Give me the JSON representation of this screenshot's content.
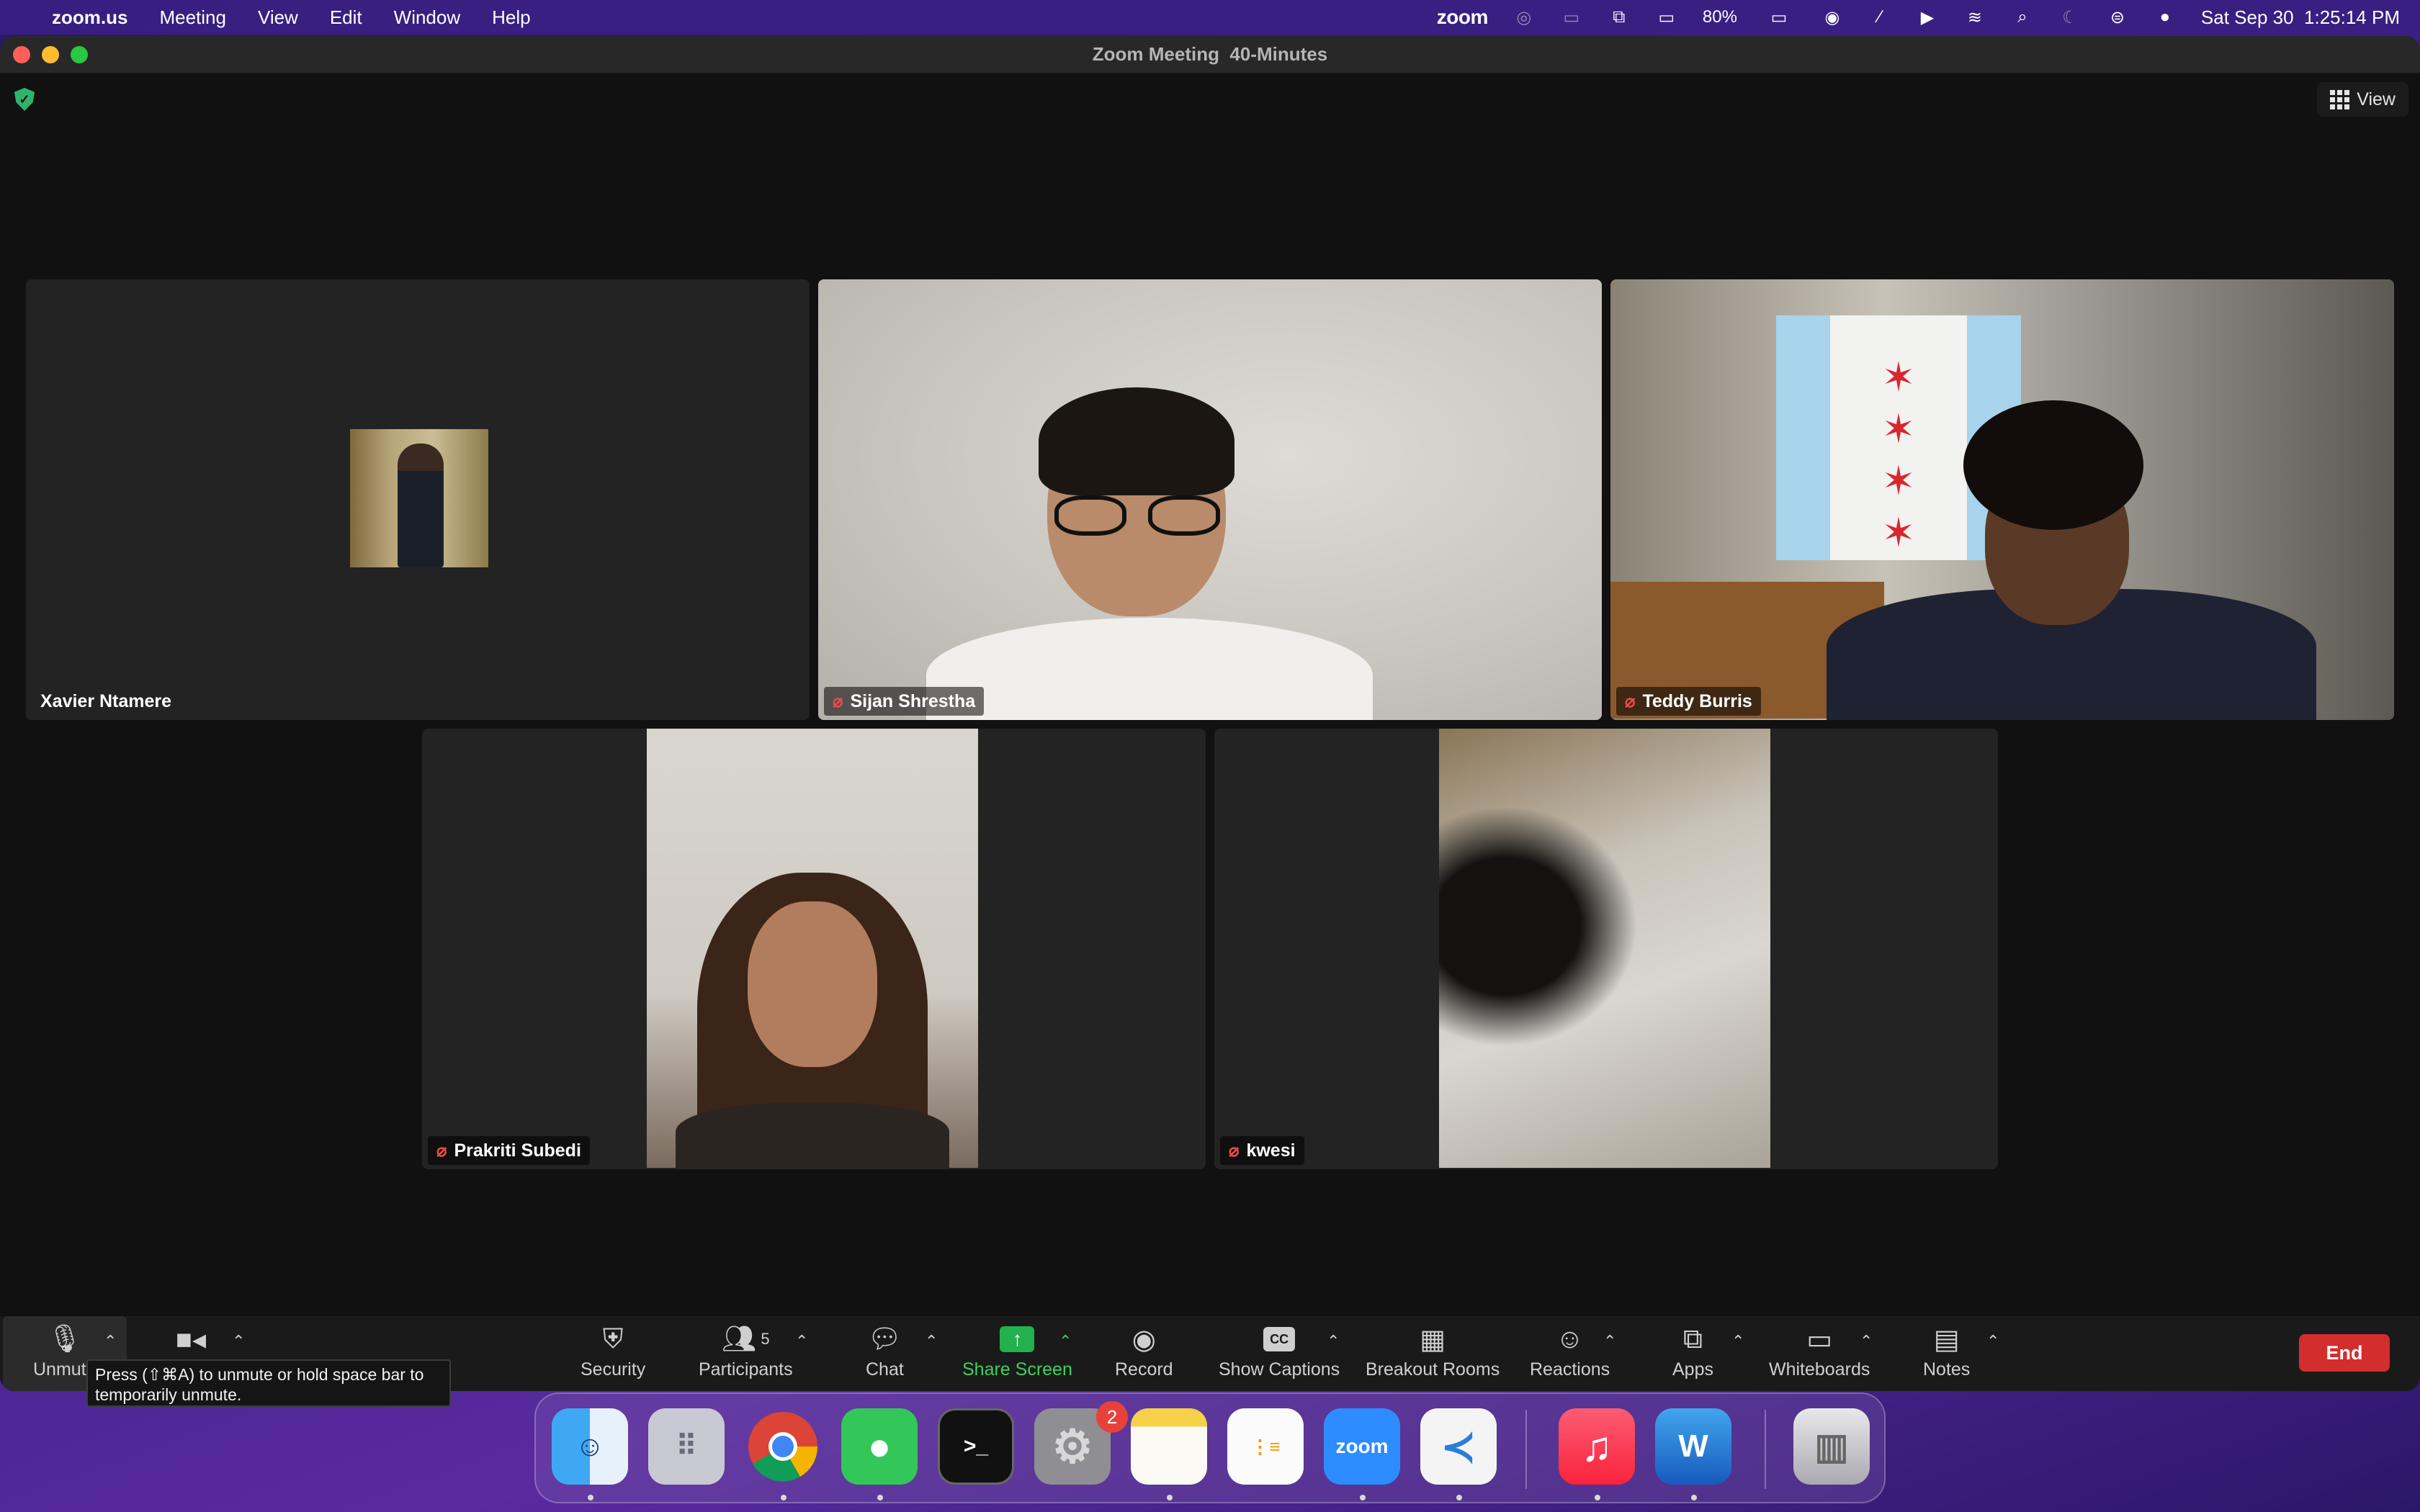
{
  "menubar": {
    "app_name": "zoom.us",
    "menus": [
      "Meeting",
      "View",
      "Edit",
      "Window",
      "Help"
    ],
    "zoom_label": "zoom",
    "battery": "80%",
    "datetime": "Sat Sep 30  1:25:14 PM"
  },
  "window": {
    "title": "Zoom Meeting  40-Minutes",
    "view_label": "View"
  },
  "participants": {
    "xavier": "Xavier Ntamere",
    "sijan": "Sijan Shrestha",
    "teddy": "Teddy Burris",
    "prakriti": "Prakriti Subedi",
    "kwesi": "kwesi"
  },
  "toolbar": {
    "unmute": "Unmute",
    "security": "Security",
    "participants": "Participants",
    "participants_count": "5",
    "chat": "Chat",
    "share_screen": "Share Screen",
    "record": "Record",
    "show_captions": "Show Captions",
    "breakout_rooms": "Breakout Rooms",
    "reactions": "Reactions",
    "apps": "Apps",
    "whiteboards": "Whiteboards",
    "notes": "Notes",
    "end": "End",
    "cc": "CC"
  },
  "tooltip": {
    "line1": "Press  (⇧⌘A) to unmute or hold space bar to",
    "line2": "temporarily unmute."
  },
  "dock": {
    "system_settings_badge": "2",
    "zoom_label": "zoom"
  },
  "colors": {
    "active_speaker": "#3ed15b",
    "end_button": "#d42d2d",
    "share_screen": "#22b14c",
    "muted": "#f04a4a"
  }
}
